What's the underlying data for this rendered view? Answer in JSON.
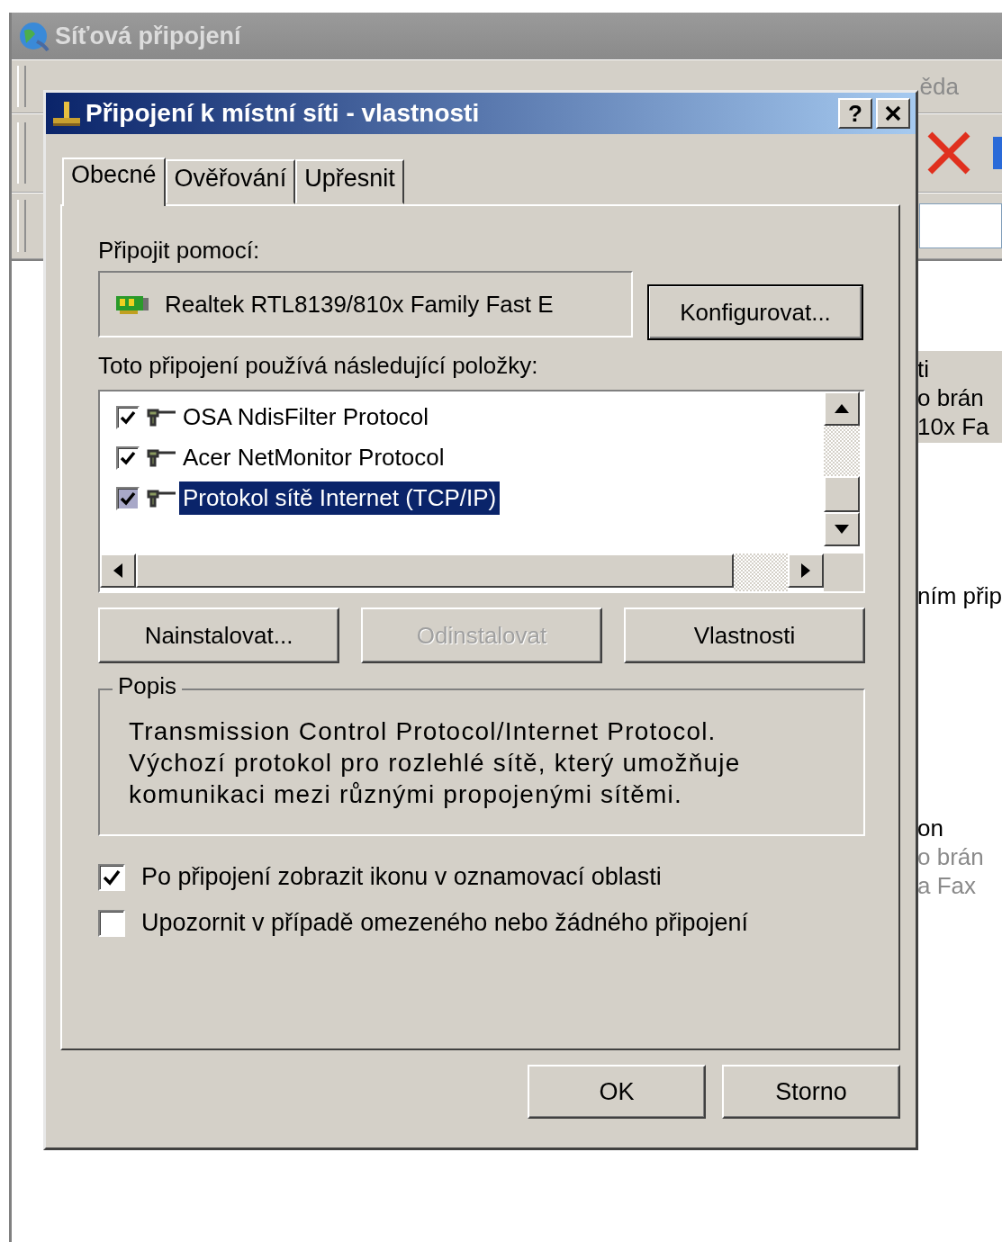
{
  "background_window": {
    "title": "Síťová připojení",
    "menu_fragment": "ěda",
    "side_groups": [
      {
        "selected": true,
        "lines": [
          "ti",
          "o brán",
          "10x Fa"
        ]
      },
      {
        "selected": false,
        "lines": [
          "ním přip"
        ]
      },
      {
        "selected": false,
        "lines": [
          "on",
          "o brán",
          "a Fax"
        ]
      }
    ]
  },
  "dialog": {
    "title": "Připojení k místní síti - vlastnosti",
    "help_button": "?",
    "tabs": [
      {
        "label": "Obecné",
        "selected": true
      },
      {
        "label": "Ověřování",
        "selected": false
      },
      {
        "label": "Upřesnit",
        "selected": false
      }
    ],
    "connect_using_label": "Připojit pomocí:",
    "adapter": "Realtek RTL8139/810x Family Fast E",
    "configure_button": "Konfigurovat...",
    "components_label": "Toto připojení používá následující položky:",
    "components": [
      {
        "label": "OSA NdisFilter Protocol",
        "checked": true,
        "selected": false
      },
      {
        "label": "Acer NetMonitor Protocol",
        "checked": true,
        "selected": false
      },
      {
        "label": "Protokol sítě Internet (TCP/IP)",
        "checked": true,
        "selected": true
      }
    ],
    "component_buttons": [
      {
        "label": "Nainstalovat...",
        "disabled": false
      },
      {
        "label": "Odinstalovat",
        "disabled": true
      },
      {
        "label": "Vlastnosti",
        "disabled": false
      }
    ],
    "description": {
      "title": "Popis",
      "text": "Transmission Control Protocol/Internet Protocol. Výchozí protokol pro rozlehlé sítě, který umožňuje komunikaci mezi různými propojenými sítěmi."
    },
    "options": [
      {
        "label": "Po připojení zobrazit ikonu v oznamovací oblasti",
        "checked": true
      },
      {
        "label": "Upozornit v případě omezeného nebo žádného připojení",
        "checked": false
      }
    ],
    "buttons": [
      "OK",
      "Storno"
    ]
  }
}
